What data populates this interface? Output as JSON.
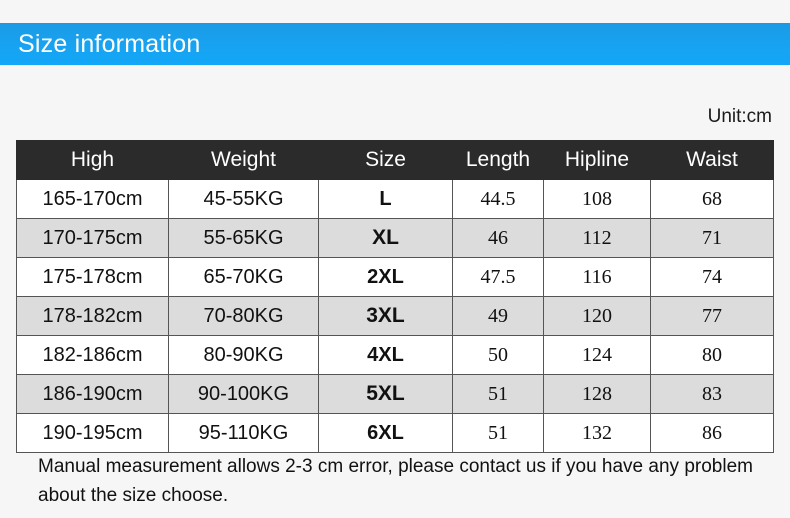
{
  "banner": {
    "title": "Size information",
    "accent_color": "#13a2f0"
  },
  "unit": {
    "label": "Unit:cm"
  },
  "table": {
    "headers": [
      "High",
      "Weight",
      "Size",
      "Length",
      "Hipline",
      "Waist"
    ],
    "rows": [
      {
        "high": "165-170cm",
        "weight": "45-55KG",
        "size": "L",
        "length": "44.5",
        "hipline": "108",
        "waist": "68"
      },
      {
        "high": "170-175cm",
        "weight": "55-65KG",
        "size": "XL",
        "length": "46",
        "hipline": "112",
        "waist": "71"
      },
      {
        "high": "175-178cm",
        "weight": "65-70KG",
        "size": "2XL",
        "length": "47.5",
        "hipline": "116",
        "waist": "74"
      },
      {
        "high": "178-182cm",
        "weight": "70-80KG",
        "size": "3XL",
        "length": "49",
        "hipline": "120",
        "waist": "77"
      },
      {
        "high": "182-186cm",
        "weight": "80-90KG",
        "size": "4XL",
        "length": "50",
        "hipline": "124",
        "waist": "80"
      },
      {
        "high": "186-190cm",
        "weight": "90-100KG",
        "size": "5XL",
        "length": "51",
        "hipline": "128",
        "waist": "83"
      },
      {
        "high": "190-195cm",
        "weight": "95-110KG",
        "size": "6XL",
        "length": "51",
        "hipline": "132",
        "waist": "86"
      }
    ]
  },
  "note": {
    "text": "Manual measurement allows 2-3 cm error, please contact us if you have any problem about the size choose."
  }
}
